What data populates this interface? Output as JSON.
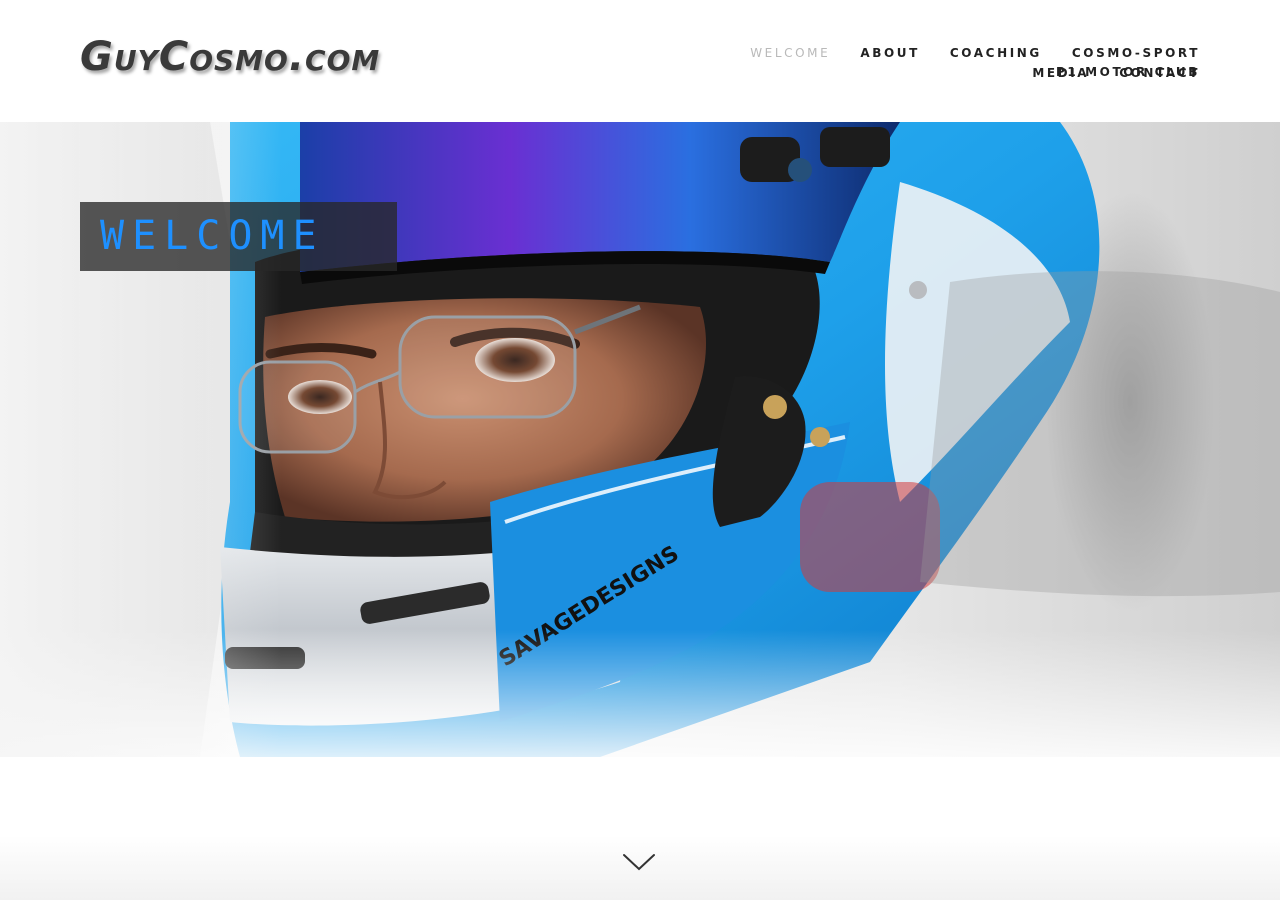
{
  "site": {
    "logo_text": "GuyCosmo.com"
  },
  "nav": {
    "row1": [
      {
        "label": "Welcome",
        "active": true
      },
      {
        "label": "About",
        "active": false
      },
      {
        "label": "Coaching",
        "active": false
      },
      {
        "label": "Cosmo-Sport",
        "active": false
      },
      {
        "label": "P1 Motor Club",
        "active": false
      }
    ],
    "row2": [
      {
        "label": "Media",
        "active": false
      },
      {
        "label": "Contact",
        "active": false
      }
    ]
  },
  "hero": {
    "title": "WELCOME",
    "title_color": "#1e90ff",
    "helmet_brand_text": "SAVAGEDESIGNS"
  },
  "icons": {
    "scroll_down": "chevron-down-icon"
  },
  "colors": {
    "nav_text": "#222222",
    "nav_active": "#b9b9b9",
    "helmet_blue": "#1ea0ea"
  }
}
